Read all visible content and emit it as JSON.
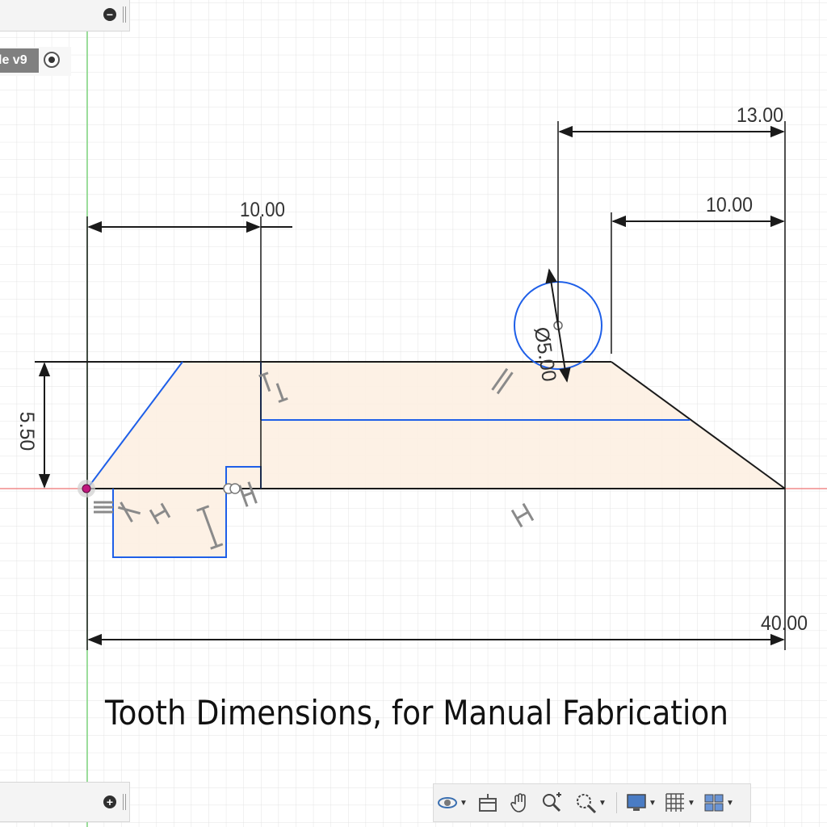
{
  "browser": {
    "component_label": "le v9"
  },
  "sketch": {
    "caption": "Tooth Dimensions, for Manual Fabrication",
    "dimensions": {
      "top_left_width": "10.00",
      "height": "5.50",
      "circle_offset": "13.00",
      "right_offset": "10.00",
      "circle_diameter": "Ø5.00",
      "overall_length": "40.00"
    }
  },
  "toolbar": {
    "icons": [
      "orbit-icon",
      "look-at-icon",
      "pan-icon",
      "zoom-icon",
      "fit-icon",
      "display-settings-icon",
      "grid-settings-icon",
      "viewports-icon"
    ]
  },
  "colors": {
    "grid_line": "#e0e0e0",
    "profile_fill": "#fdf0e2",
    "sketch_blue": "#1e5fe8",
    "dimension_black": "#1a1a1a",
    "x_axis": "#f08a8a",
    "y_axis": "#7ed67e",
    "origin": "#c0187e"
  }
}
